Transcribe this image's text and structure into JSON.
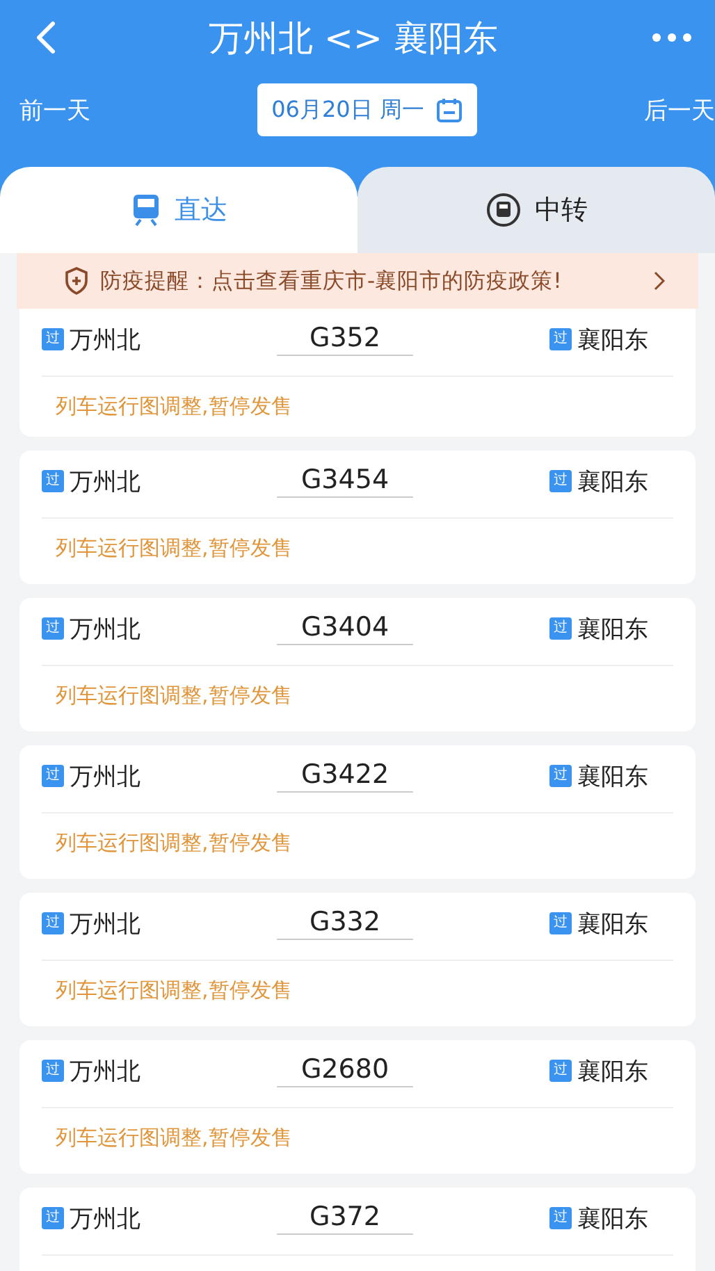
{
  "header": {
    "title": "万州北 <> 襄阳东"
  },
  "date_nav": {
    "prev": "前一天",
    "date": "06月20日 周一",
    "next": "后一天"
  },
  "tabs": [
    {
      "label": "直达",
      "selected": true
    },
    {
      "label": "中转",
      "selected": false
    }
  ],
  "notice": {
    "text": "防疫提醒：点击查看重庆市-襄阳市的防疫政策!"
  },
  "trains": [
    {
      "from_badge": "过",
      "from": "万州北",
      "number": "G352",
      "to_badge": "过",
      "to": "襄阳东",
      "status": "列车运行图调整,暂停发售"
    },
    {
      "from_badge": "过",
      "from": "万州北",
      "number": "G3454",
      "to_badge": "过",
      "to": "襄阳东",
      "status": "列车运行图调整,暂停发售"
    },
    {
      "from_badge": "过",
      "from": "万州北",
      "number": "G3404",
      "to_badge": "过",
      "to": "襄阳东",
      "status": "列车运行图调整,暂停发售"
    },
    {
      "from_badge": "过",
      "from": "万州北",
      "number": "G3422",
      "to_badge": "过",
      "to": "襄阳东",
      "status": "列车运行图调整,暂停发售"
    },
    {
      "from_badge": "过",
      "from": "万州北",
      "number": "G332",
      "to_badge": "过",
      "to": "襄阳东",
      "status": "列车运行图调整,暂停发售"
    },
    {
      "from_badge": "过",
      "from": "万州北",
      "number": "G2680",
      "to_badge": "过",
      "to": "襄阳东",
      "status": "列车运行图调整,暂停发售"
    },
    {
      "from_badge": "过",
      "from": "万州北",
      "number": "G372",
      "to_badge": "过",
      "to": "襄阳东"
    }
  ]
}
